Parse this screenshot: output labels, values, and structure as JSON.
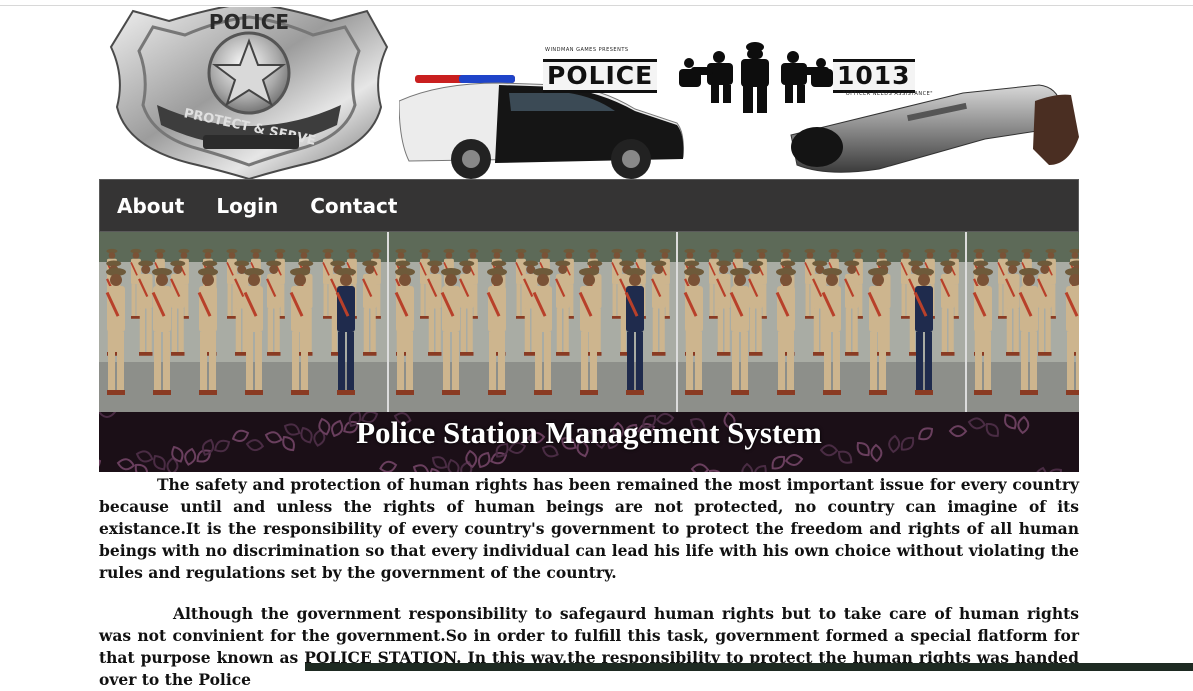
{
  "header": {
    "badge": {
      "top_text": "POLICE",
      "ribbon_text": "PROTECT & SERVE"
    },
    "logo": {
      "small_text": "WINDMAN GAMES PRESENTS",
      "word_left": "POLICE",
      "word_right": "1013",
      "tagline": "\"OFFICER NEEDS ASSISTANCE\""
    }
  },
  "nav": {
    "items": [
      {
        "label": "About"
      },
      {
        "label": "Login"
      },
      {
        "label": "Contact"
      }
    ]
  },
  "site_title": "Police Station Management System",
  "content": {
    "paragraph1": "The safety and protection of human rights has been remained the most important issue for every country because until and unless the rights of human beings are not protected, no country can imagine of its existance.It is the responsibility of every country's government to protect the freedom and rights of all human beings with no discrimination so that every individual can lead his life with his own choice without violating the rules and regulations set by the government of the country.",
    "paragraph2": "Although the government responsibility to safegaurd human rights but to take care of human rights was not convinient for the government.So in order to fulfill this task, government formed a special flatform for that purpose known as POLICE STATION. In this way,the responsibility to protect the human rights was handed over to the Police"
  },
  "colors": {
    "nav_bg": "#353434",
    "nav_text": "#ffffff",
    "title_band_bg": "#1b0f17",
    "uniform": "#cdb58e",
    "body_text": "#111111"
  }
}
